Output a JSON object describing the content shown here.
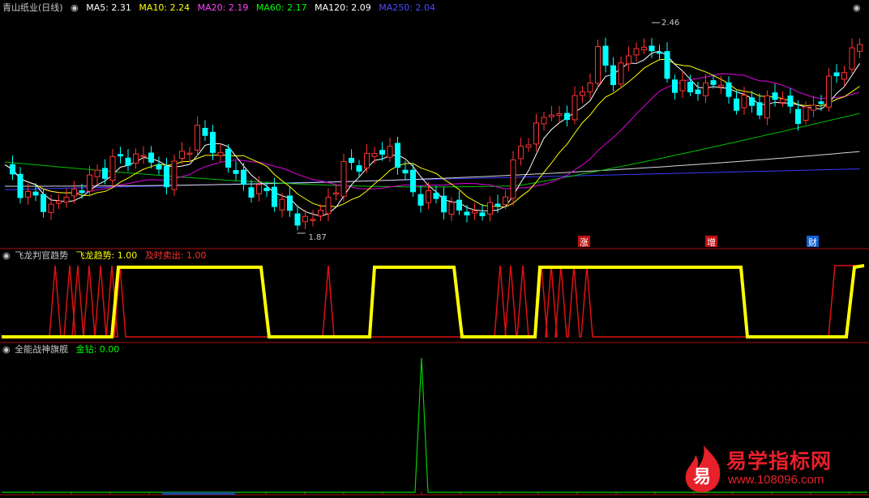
{
  "main": {
    "title": "青山纸业(日线)",
    "indicators": [
      {
        "label": "MA5: 2.31",
        "color": "#ffffff"
      },
      {
        "label": "MA10: 2.24",
        "color": "#ffff00"
      },
      {
        "label": "MA20: 2.19",
        "color": "#ff00ff"
      },
      {
        "label": "MA60: 2.17",
        "color": "#00ff00"
      },
      {
        "label": "MA120: 2.09",
        "color": "#ffffff"
      },
      {
        "label": "MA250: 2.04",
        "color": "#4040ff"
      }
    ],
    "high_label": "2.46",
    "low_label": "1.87",
    "markers": [
      "涨",
      "增",
      "财"
    ]
  },
  "panel2": {
    "title": "飞龙判官趋势",
    "items": [
      {
        "label": "飞龙趋势: 1.00",
        "color": "#ffff00"
      },
      {
        "label": "及时卖出: 1.00",
        "color": "#ff3030"
      }
    ]
  },
  "panel3": {
    "title": "全能战神旗舰",
    "items": [
      {
        "label": "金钻: 0.00",
        "color": "#00ff00"
      }
    ]
  },
  "watermark": {
    "logo_char": "易",
    "title": "易学指标网",
    "url": "www.108096.com"
  },
  "chart_data": [
    {
      "type": "candlestick",
      "title": "青山纸业(日线)",
      "high": 2.46,
      "low": 1.87,
      "series": [
        {
          "name": "MA5",
          "last": 2.31
        },
        {
          "name": "MA10",
          "last": 2.24
        },
        {
          "name": "MA20",
          "last": 2.19
        },
        {
          "name": "MA60",
          "last": 2.17
        },
        {
          "name": "MA120",
          "last": 2.09
        },
        {
          "name": "MA250",
          "last": 2.04
        }
      ]
    },
    {
      "type": "line",
      "title": "飞龙判官趋势",
      "series": [
        {
          "name": "飞龙趋势",
          "last": 1.0
        },
        {
          "name": "及时卖出",
          "last": 1.0
        }
      ],
      "ylim": [
        0,
        1
      ]
    },
    {
      "type": "line",
      "title": "全能战神旗舰",
      "series": [
        {
          "name": "金钻",
          "last": 0.0
        }
      ],
      "ylim": [
        0,
        1
      ]
    }
  ]
}
